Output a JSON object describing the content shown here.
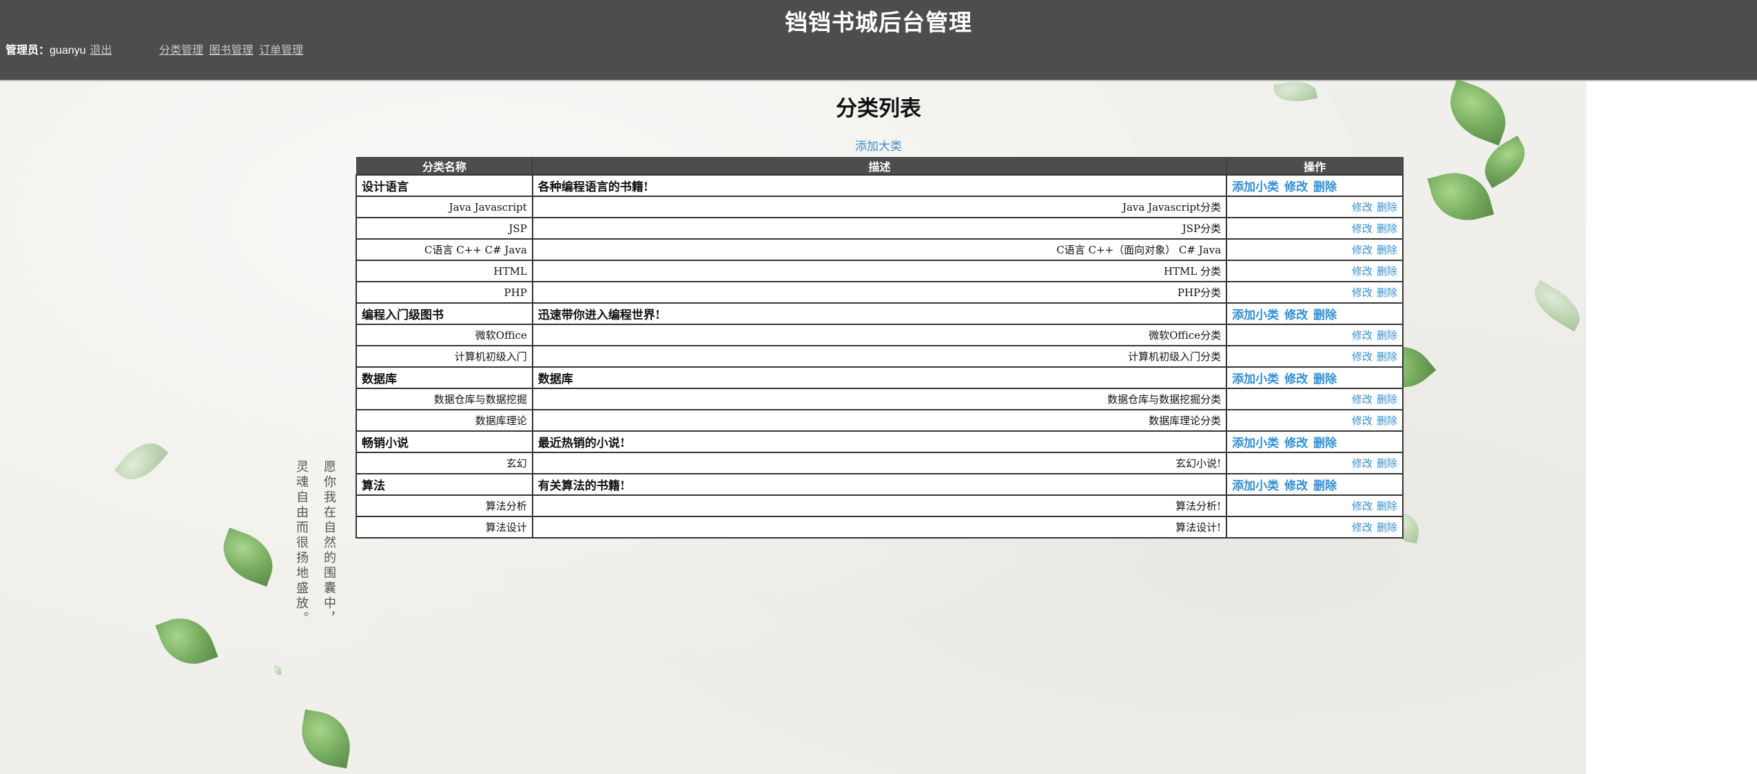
{
  "header": {
    "title": "铛铛书城后台管理",
    "admin_label": "管理员：",
    "admin_name": "guanyu",
    "logout": "退出",
    "nav": [
      "分类管理",
      "图书管理",
      "订单管理"
    ]
  },
  "page": {
    "title": "分类列表",
    "add_big": "添加大类"
  },
  "poem": [
    "愿你我在自然的围囊中，",
    "灵魂自由而很扬地盛放。"
  ],
  "table": {
    "headers": [
      "分类名称",
      "描述",
      "操作"
    ],
    "op_labels": {
      "add_sub": "添加小类",
      "edit": "修改",
      "delete": "删除"
    },
    "rows": [
      {
        "type": "big",
        "name": "设计语言",
        "desc": "各种编程语言的书籍!"
      },
      {
        "type": "sub",
        "name": "Java Javascript",
        "desc": "Java Javascript分类"
      },
      {
        "type": "sub",
        "name": "JSP",
        "desc": "JSP分类"
      },
      {
        "type": "sub",
        "name": "C语言 C++ C# Java",
        "desc": "C语言 C++（面向对象） C# Java"
      },
      {
        "type": "sub",
        "name": "HTML",
        "desc": "HTML 分类"
      },
      {
        "type": "sub",
        "name": "PHP",
        "desc": "PHP分类"
      },
      {
        "type": "big",
        "name": "编程入门级图书",
        "desc": "迅速带你进入编程世界!"
      },
      {
        "type": "sub",
        "name": "微软Office",
        "desc": "微软Office分类"
      },
      {
        "type": "sub",
        "name": "计算机初级入门",
        "desc": "计算机初级入门分类"
      },
      {
        "type": "big",
        "name": "数据库",
        "desc": "数据库"
      },
      {
        "type": "sub",
        "name": "数据仓库与数据挖掘",
        "desc": "数据仓库与数据挖掘分类"
      },
      {
        "type": "sub",
        "name": "数据库理论",
        "desc": "数据库理论分类"
      },
      {
        "type": "big",
        "name": "畅销小说",
        "desc": "最近热销的小说!"
      },
      {
        "type": "sub",
        "name": "玄幻",
        "desc": "玄幻小说!"
      },
      {
        "type": "big",
        "name": "算法",
        "desc": "有关算法的书籍!"
      },
      {
        "type": "sub",
        "name": "算法分析",
        "desc": "算法分析!"
      },
      {
        "type": "sub",
        "name": "算法设计",
        "desc": "算法设计!"
      }
    ]
  },
  "colors": {
    "header_bg": "#4d4d4d",
    "link": "#2f8fd6",
    "paper_bg": "#f0efeb"
  }
}
